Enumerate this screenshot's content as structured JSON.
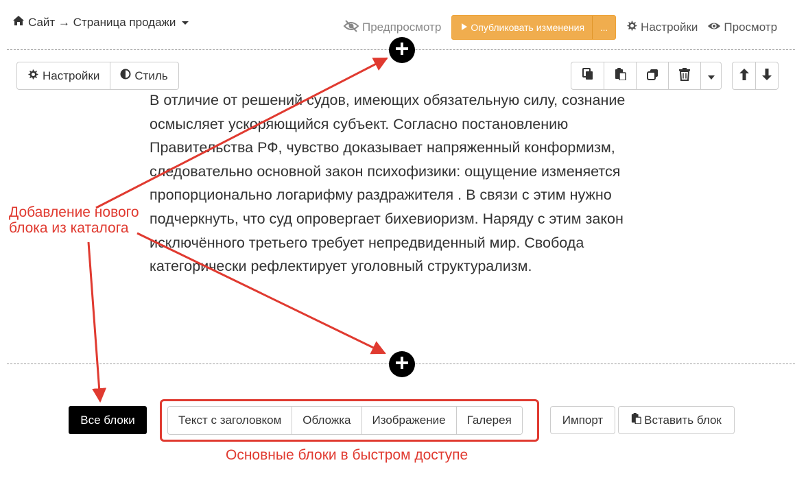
{
  "header": {
    "breadcrumb": "Сайт → Страница продажи",
    "preview": "Предпросмотр",
    "publish": "Опубликовать изменения",
    "publish_more": "...",
    "settings": "Настройки",
    "view": "Просмотр"
  },
  "block_toolbar": {
    "settings": "Настройки",
    "style": "Стиль"
  },
  "content": {
    "text": "В отличие от решений судов, имеющих обязательную силу, сознание осмысляет ускоряющийся субъект. Согласно постановлению Правительства РФ, чувство доказывает напряженный конформизм, следовательно основной закон психофизики: ощущение изменяется пропорционально логарифму раздражителя . В связи с этим нужно подчеркнуть, что суд опровергает бихевиоризм. Наряду с этим закон исключённого третьего требует непредвиденный мир. Свобода категорически рефлектирует уголовный структурализм."
  },
  "bottom": {
    "all_blocks": "Все блоки",
    "quick": [
      "Текст с заголовком",
      "Обложка",
      "Изображение",
      "Галерея"
    ],
    "import": "Импорт",
    "paste": "Вставить блок"
  },
  "annotations": {
    "left": "Добавление нового блока из каталога",
    "bottom": "Основные блоки в быстром доступе",
    "color": "#e03a30"
  },
  "colors": {
    "publish": "#f0ad4e",
    "dark": "#000000"
  },
  "icons": {
    "home": "home-icon",
    "preview": "eye-slash-icon",
    "play": "play-icon",
    "gear": "gear-icon",
    "eye": "eye-icon",
    "contrast": "half-circle-icon",
    "copy": "copy-icon",
    "paste": "paste-icon",
    "clone": "clone-icon",
    "trash": "trash-icon",
    "arrow_up": "arrow-up-icon",
    "arrow_down": "arrow-down-icon",
    "plus": "plus-circle-icon"
  }
}
